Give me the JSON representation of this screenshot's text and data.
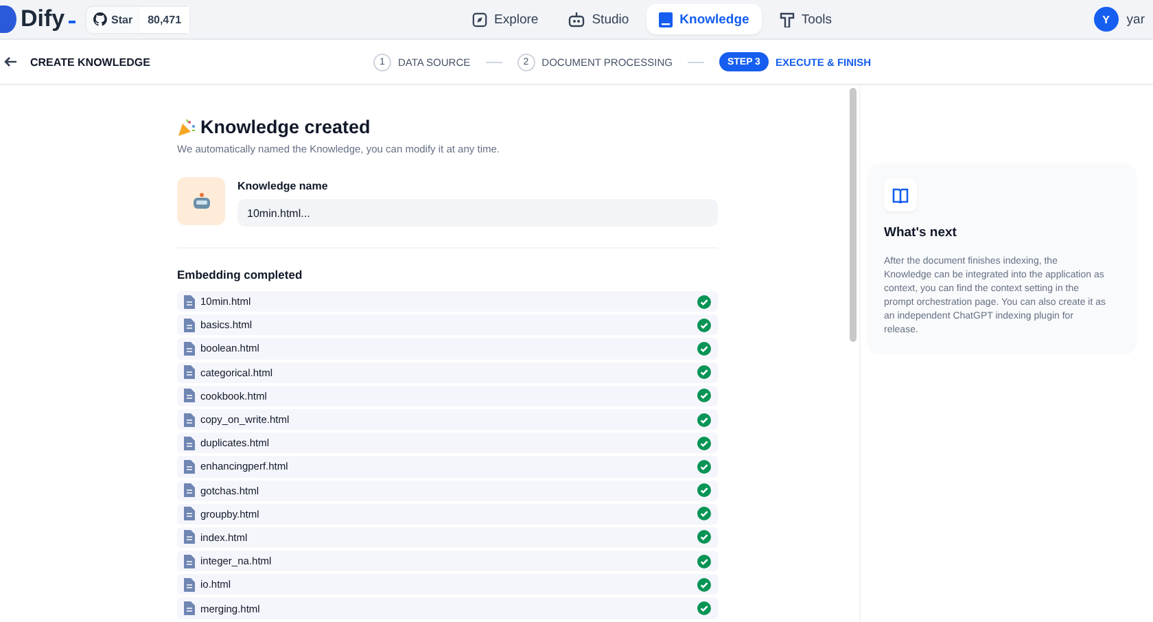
{
  "brand": {
    "name": "Dify"
  },
  "github": {
    "label": "Star",
    "count": "80,471"
  },
  "nav": [
    {
      "label": "Explore",
      "selected": false
    },
    {
      "label": "Studio",
      "selected": false
    },
    {
      "label": "Knowledge",
      "selected": true
    },
    {
      "label": "Tools",
      "selected": false
    }
  ],
  "user": {
    "initial": "Y",
    "name": "yar"
  },
  "header": {
    "title": "CREATE KNOWLEDGE"
  },
  "steps": [
    {
      "number": "1",
      "label": "DATA SOURCE",
      "selected": false
    },
    {
      "number": "2",
      "label": "DOCUMENT PROCESSING",
      "selected": false
    },
    {
      "number": "STEP 3",
      "label": "EXECUTE & FINISH",
      "selected": true
    }
  ],
  "result": {
    "title": "Knowledge created",
    "subtitle": "We automatically named the Knowledge, you can modify it at any time.",
    "name_label": "Knowledge name",
    "name_value": "10min.html..."
  },
  "embedding": {
    "title": "Embedding completed",
    "files": [
      {
        "name": "10min.html",
        "completed": true
      },
      {
        "name": "basics.html",
        "completed": true
      },
      {
        "name": "boolean.html",
        "completed": true
      },
      {
        "name": "categorical.html",
        "completed": true
      },
      {
        "name": "cookbook.html",
        "completed": true
      },
      {
        "name": "copy_on_write.html",
        "completed": true
      },
      {
        "name": "duplicates.html",
        "completed": true
      },
      {
        "name": "enhancingperf.html",
        "completed": true
      },
      {
        "name": "gotchas.html",
        "completed": true
      },
      {
        "name": "groupby.html",
        "completed": true
      },
      {
        "name": "index.html",
        "completed": true
      },
      {
        "name": "integer_na.html",
        "completed": true
      },
      {
        "name": "io.html",
        "completed": true
      },
      {
        "name": "merging.html",
        "completed": true
      }
    ]
  },
  "next": {
    "title": "What's next",
    "text": "After the document finishes indexing, the Knowledge can be integrated into the application as context, you can find the context setting in the prompt orchestration page. You can also create it as an independent ChatGPT indexing plugin for release."
  }
}
